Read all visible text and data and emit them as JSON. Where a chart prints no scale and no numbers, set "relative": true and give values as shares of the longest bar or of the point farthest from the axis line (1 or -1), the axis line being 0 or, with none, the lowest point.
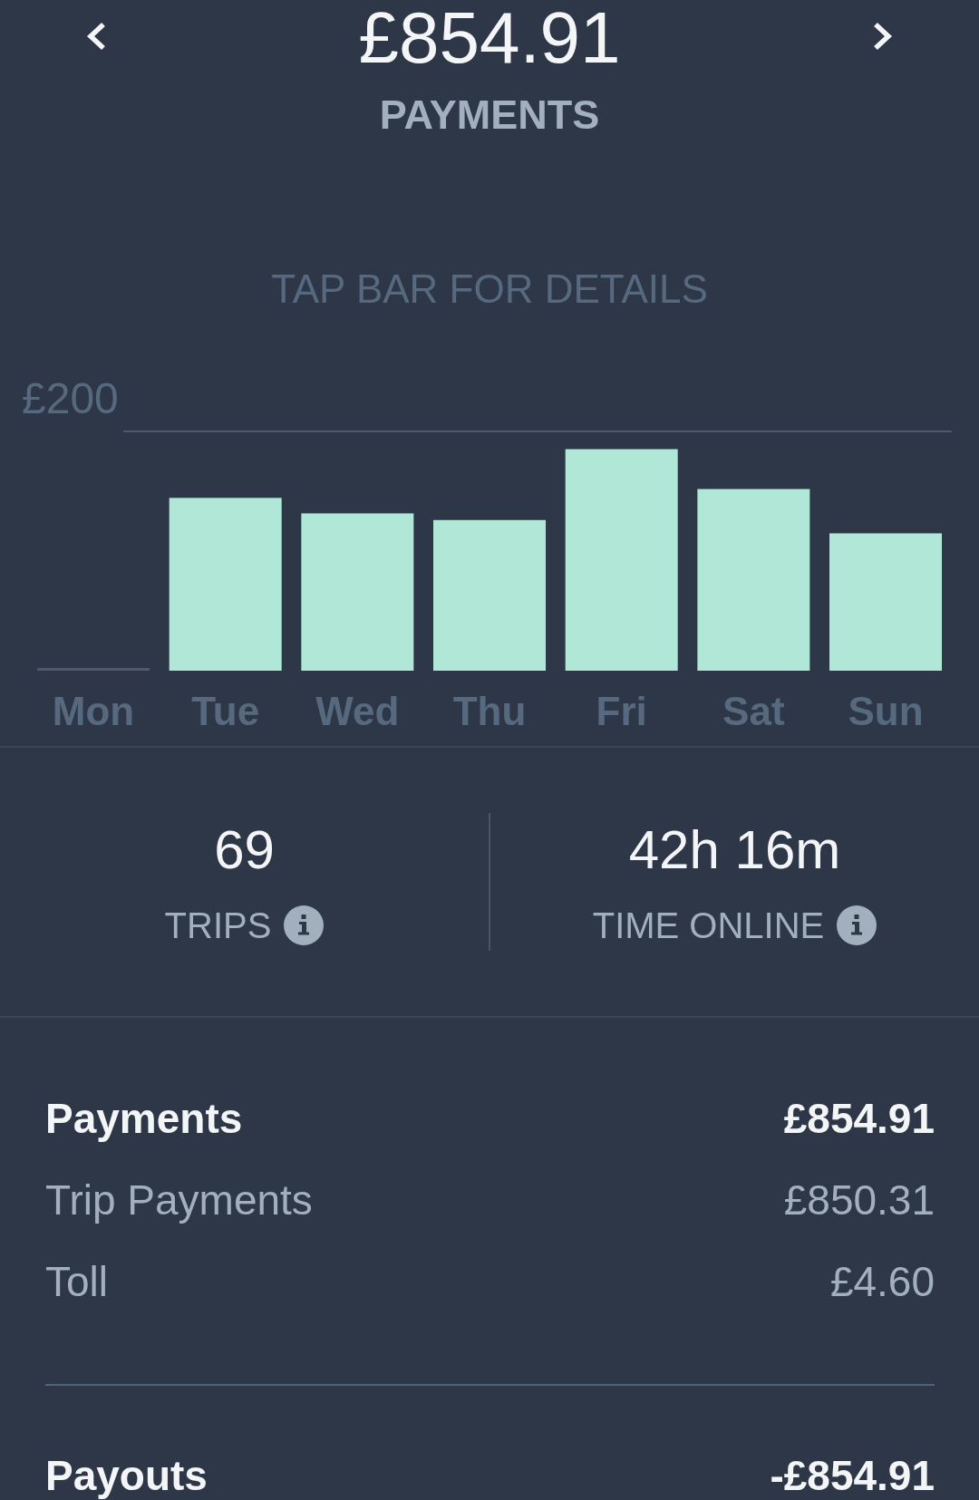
{
  "header": {
    "amount": "£854.91",
    "label": "PAYMENTS"
  },
  "chart": {
    "hint": "TAP BAR FOR DETAILS",
    "chart_data": {
      "type": "bar",
      "relative": true,
      "categories": [
        "Mon",
        "Tue",
        "Wed",
        "Thu",
        "Fri",
        "Sat",
        "Sun"
      ],
      "values": [
        0,
        0.78,
        0.71,
        0.68,
        1,
        0.82,
        0.62
      ],
      "annotations": [
        "£200"
      ]
    }
  },
  "stats": [
    {
      "value": "69",
      "label": "TRIPS"
    },
    {
      "value": "42h 16m",
      "label": "TIME ONLINE"
    }
  ],
  "sections": [
    {
      "label": "Payments",
      "amount": "£854.91",
      "items": [
        {
          "label": "Trip Payments",
          "amount": "£850.31"
        },
        {
          "label": "Toll",
          "amount": "£4.60"
        }
      ]
    },
    {
      "label": "Payouts",
      "amount": "-£854.91"
    }
  ]
}
